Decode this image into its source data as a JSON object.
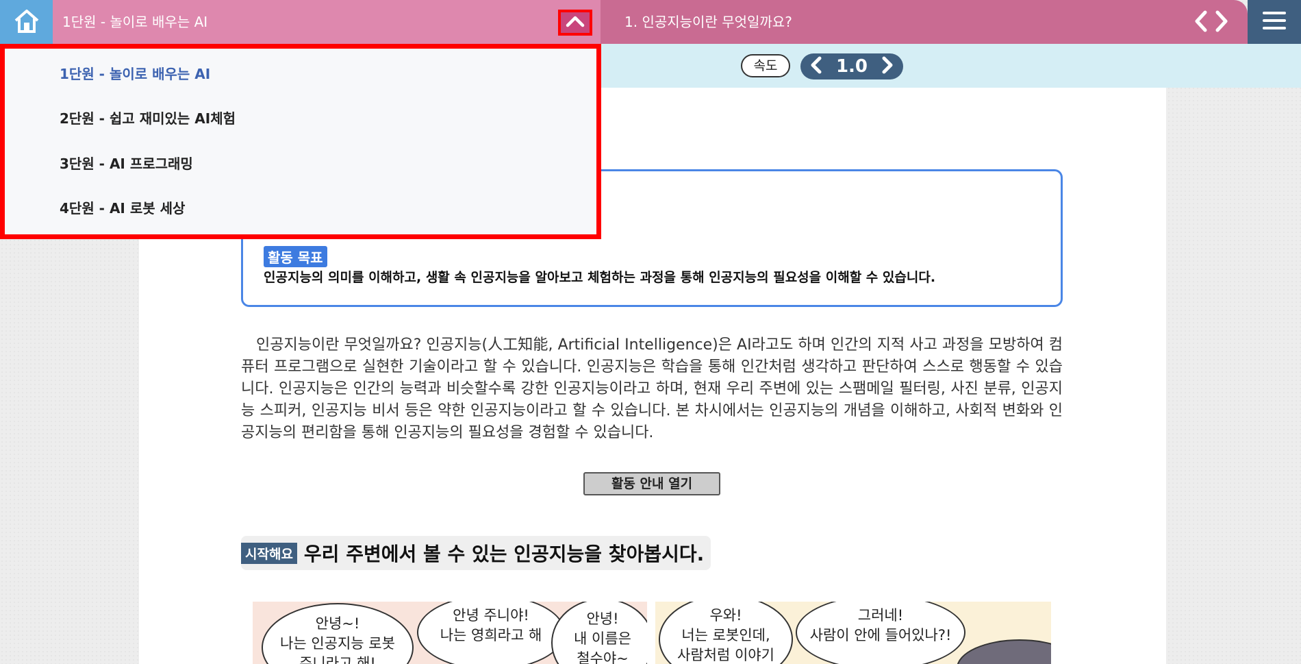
{
  "header": {
    "unit_title": "1단원 - 놀이로 배우는 AI",
    "lesson_title": "1. 인공지능이란 무엇일까요?"
  },
  "speed": {
    "label": "속도",
    "value": "1.0"
  },
  "goal": {
    "badge": "활동 목표",
    "text": "인공지능의 의미를 이해하고, 생활 속 인공지능을 알아보고 체험하는 과정을 통해 인공지능의 필요성을 이해할 수 있습니다."
  },
  "intro": "인공지능이란 무엇일까요? 인공지능(人工知能, Artificial Intelligence)은 AI라고도 하며 인간의 지적 사고 과정을 모방하여 컴퓨터 프로그램으로 실현한 기술이라고 할 수 있습니다. 인공지능은 학습을 통해 인간처럼 생각하고 판단하여 스스로 행동할 수 있습니다. 인공지능은 인간의 능력과 비슷할수록 강한 인공지능이라고 하며, 현재 우리 주변에 있는 스팸메일 필터링, 사진 분류, 인공지능 스피커, 인공지능 비서 등은 약한 인공지능이라고 할 수 있습니다. 본 차시에서는 인공지능의 개념을 이해하고, 사회적 변화와 인공지능의 편리함을 통해 인공지능의 필요성을 경험할 수 있습니다.",
  "activity_button": "활동 안내 열기",
  "start": {
    "badge": "시작해요",
    "title": "우리 주변에서 볼 수 있는 인공지능을 찾아봅시다."
  },
  "cartoon": {
    "bubbles": [
      "안녕~!\n나는 인공지능 로봇\n주니라고 해!",
      "안녕 주니야!\n나는 영희라고 해",
      "안녕!\n내 이름은\n철수야~",
      "우와!\n너는 로봇인데,\n사람처럼 이야기",
      "그러네!\n사람이 안에 들어있나?!"
    ]
  },
  "dropdown": {
    "items": [
      "1단원 - 놀이로 배우는 AI",
      "2단원 - 쉽고 재미있는 AI체험",
      "3단원 - AI 프로그래밍",
      "4단원 - AI 로봇 세상"
    ]
  },
  "colors": {
    "unit_bar": "#de88ae",
    "lesson_bar": "#c96b92",
    "home": "#5fa9dd",
    "menu": "#3f5f80",
    "highlight": "#ff0000",
    "goal_border": "#4a86e6"
  },
  "icons": [
    "home-icon",
    "chevron-up-icon",
    "prev-page-icon",
    "next-page-icon",
    "hamburger-menu-icon",
    "speed-decrease-icon",
    "speed-increase-icon"
  ]
}
